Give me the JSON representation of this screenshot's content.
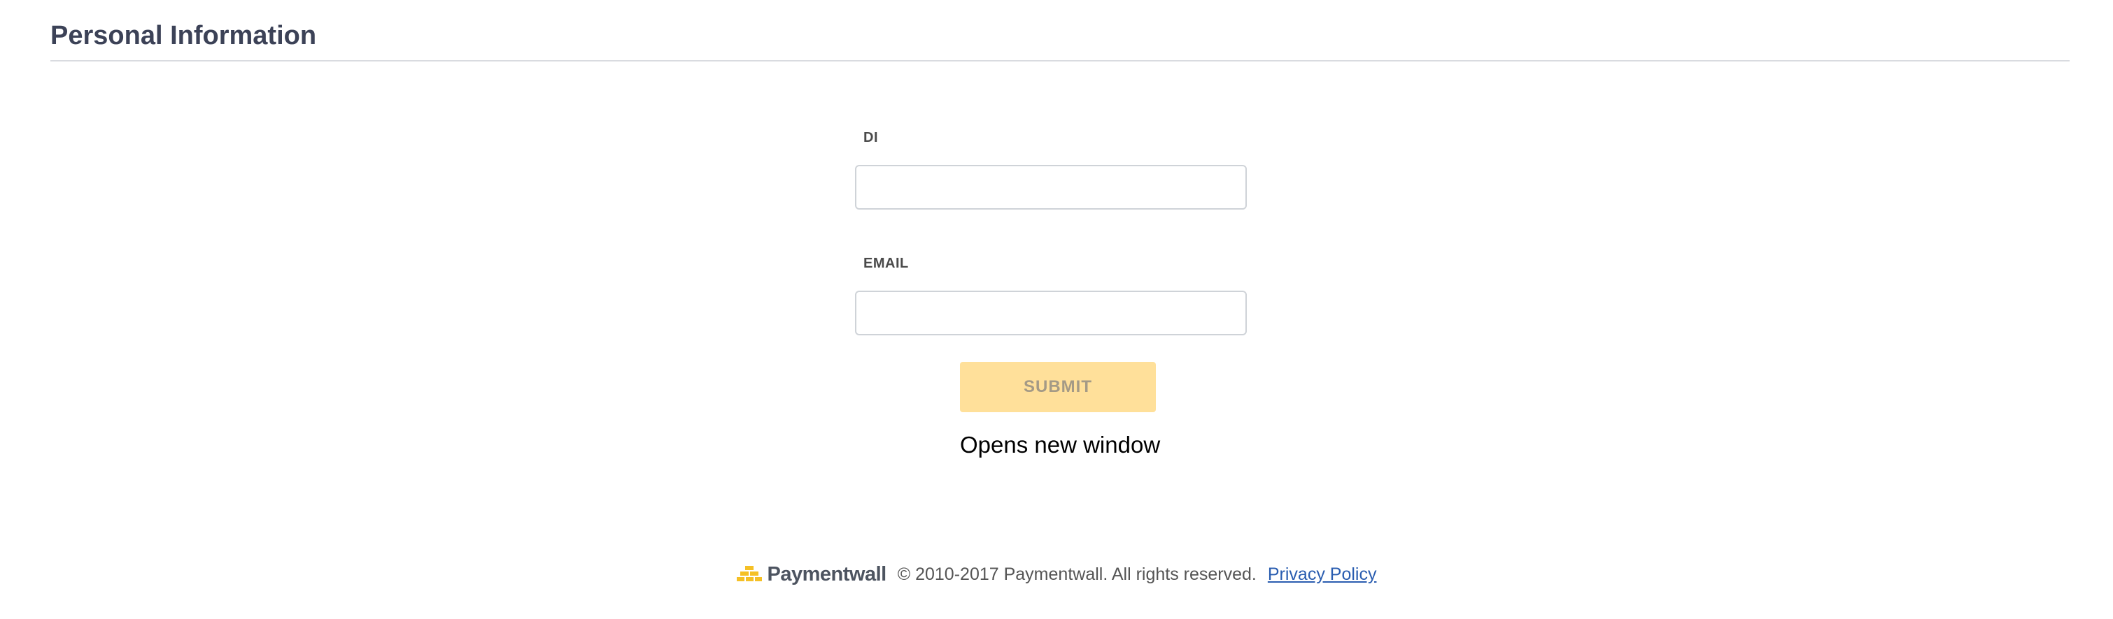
{
  "header": {
    "title": "Personal Information"
  },
  "form": {
    "fields": [
      {
        "label": "DI",
        "value": "",
        "placeholder": ""
      },
      {
        "label": "EMAIL",
        "value": "",
        "placeholder": ""
      }
    ],
    "submit_label": "SUBMIT",
    "note": "Opens new window"
  },
  "footer": {
    "logo_text": "Paymentwall",
    "logo_icon": "paymentwall-bricks-icon",
    "copyright": "© 2010-2017 Paymentwall. All rights reserved.",
    "privacy_link": "Privacy Policy"
  },
  "colors": {
    "title": "#3c4257",
    "submit_background": "#ffe09a",
    "submit_text": "#a49a86",
    "link": "#2a5db0",
    "logo_accent": "#f5c026"
  }
}
